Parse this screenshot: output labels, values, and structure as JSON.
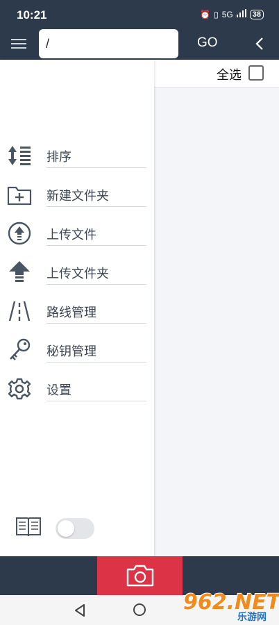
{
  "status_bar": {
    "time": "10:21",
    "network": "5G",
    "battery": "38"
  },
  "toolbar": {
    "path_value": "/",
    "go_label": "GO"
  },
  "select_all": {
    "label": "全选",
    "checked": false
  },
  "drawer": {
    "items": [
      {
        "label": "排序",
        "icon": "sort-icon"
      },
      {
        "label": "新建文件夹",
        "icon": "new-folder-icon"
      },
      {
        "label": "上传文件",
        "icon": "upload-file-icon"
      },
      {
        "label": "上传文件夹",
        "icon": "upload-folder-icon"
      },
      {
        "label": "路线管理",
        "icon": "route-icon"
      },
      {
        "label": "秘钥管理",
        "icon": "key-icon"
      },
      {
        "label": "设置",
        "icon": "gear-icon"
      }
    ],
    "toggle_on": false
  },
  "watermark": {
    "main": "962.NET",
    "sub": "乐游网"
  },
  "colors": {
    "header": "#2c3a4b",
    "camera_button": "#dc3347",
    "drawer_text": "#3d4652"
  }
}
